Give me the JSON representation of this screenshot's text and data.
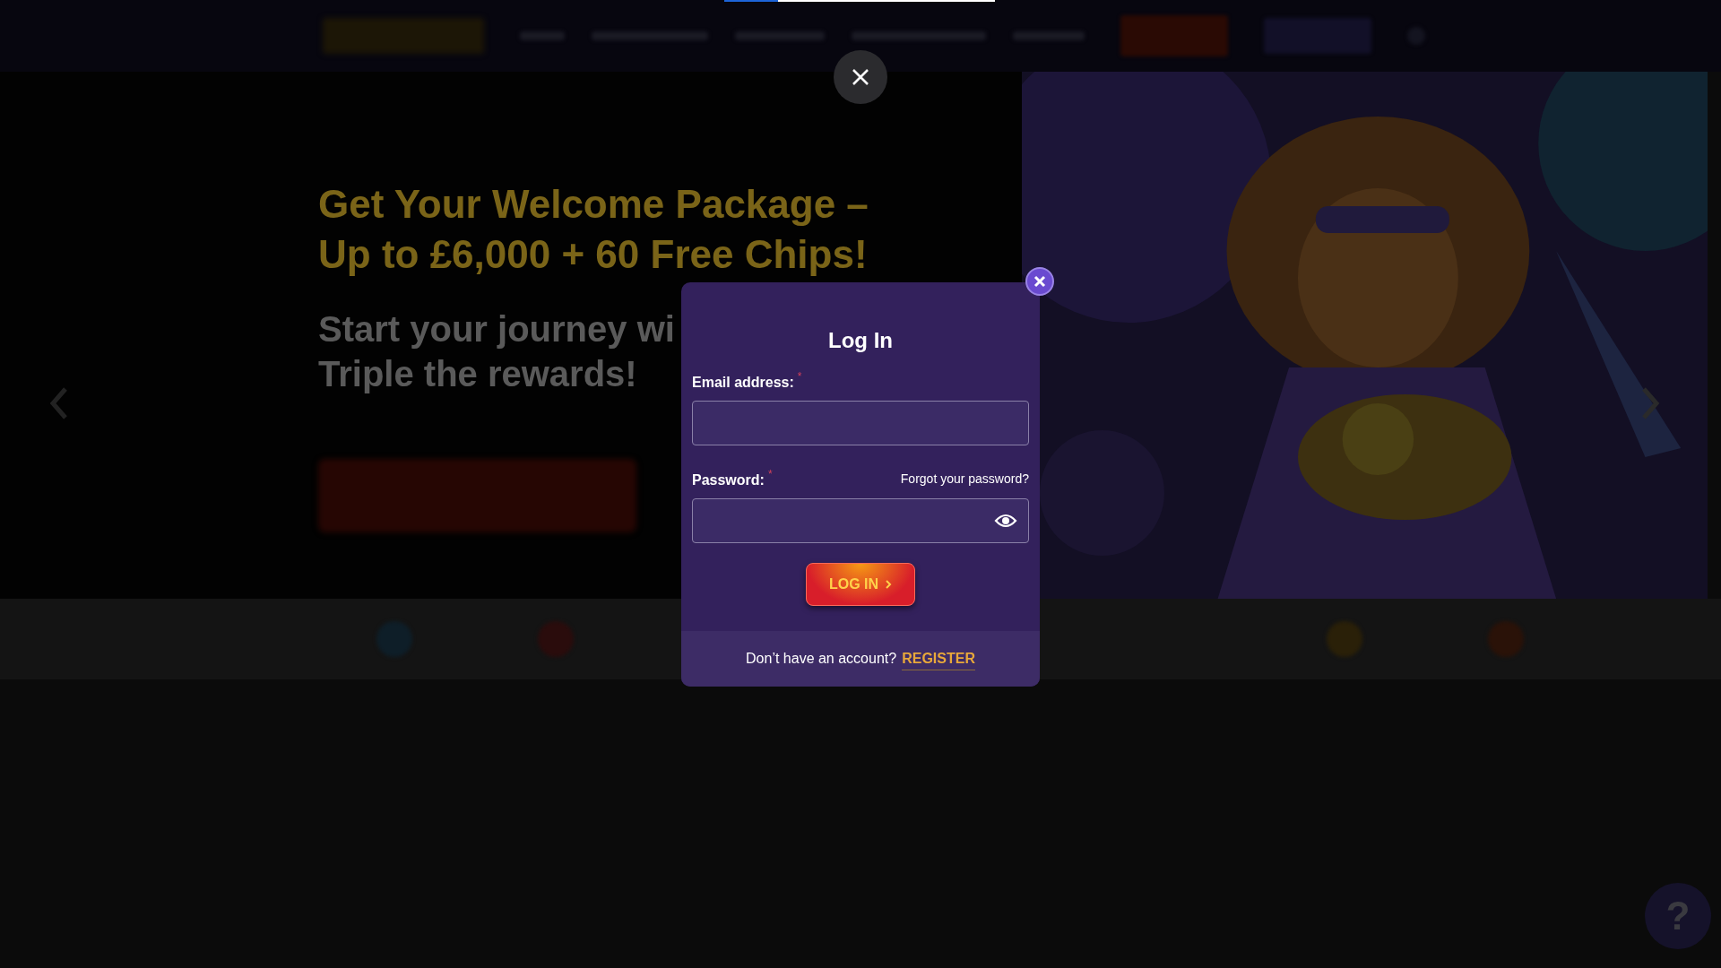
{
  "loading_bar": {
    "level": 0.2
  },
  "hero": {
    "headline": [
      "Get Your Welcome Package –",
      "Up to £6,000 + 60 Free Chips!"
    ],
    "subtitle": [
      "Start your journey wi",
      "Triple the rewards!"
    ]
  },
  "login_dialog": {
    "title": "Log In",
    "email": {
      "label": "Email address:",
      "required_mark": "*"
    },
    "password": {
      "label": "Password:",
      "required_mark": "*",
      "forgot_link": "Forgot your password?"
    },
    "submit": "LOG IN",
    "footer": {
      "text": "Don’t have an account?",
      "link": "REGISTER"
    }
  },
  "help_button": "?"
}
